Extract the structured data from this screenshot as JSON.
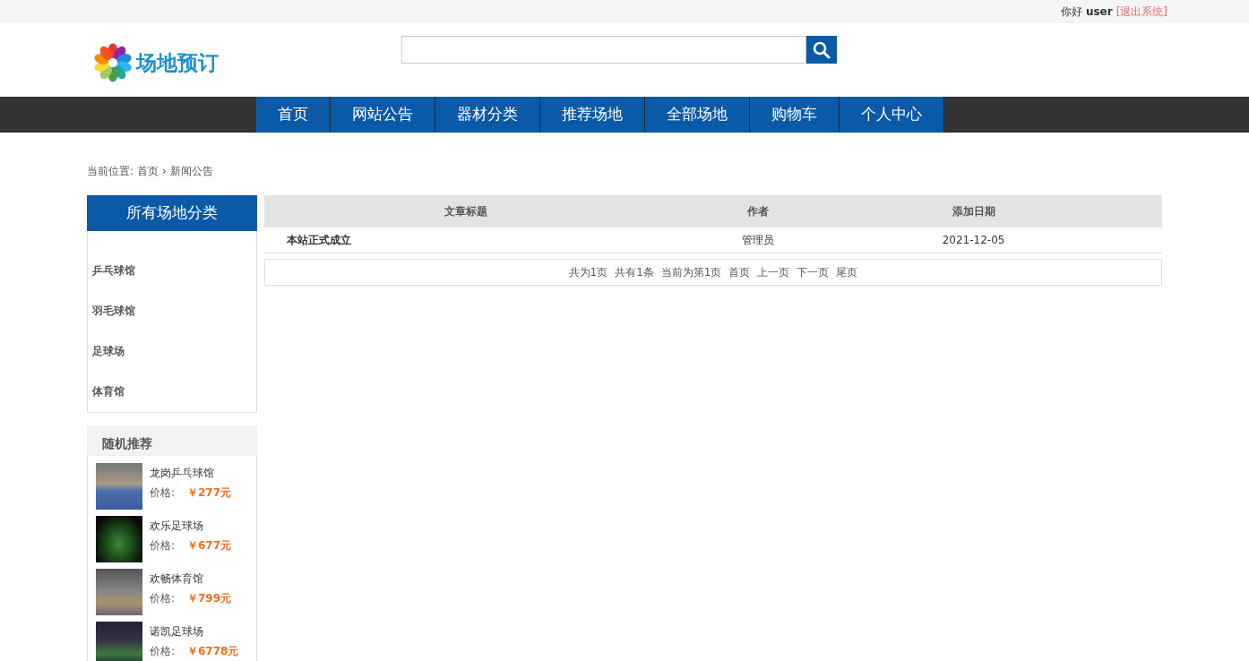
{
  "topbar": {
    "greeting": "你好",
    "username": "user",
    "logout": "[退出系统]"
  },
  "logo": {
    "text": "场地预订"
  },
  "nav": [
    {
      "label": "首页"
    },
    {
      "label": "网站公告"
    },
    {
      "label": "器材分类"
    },
    {
      "label": "推荐场地"
    },
    {
      "label": "全部场地"
    },
    {
      "label": "购物车"
    },
    {
      "label": "个人中心"
    }
  ],
  "breadcrumb": {
    "prefix": "当前位置:",
    "items": [
      "首页",
      "新闻公告"
    ],
    "separator": "›"
  },
  "sidebar": {
    "title": "所有场地分类",
    "items": [
      "乒乓球馆",
      "羽毛球馆",
      "足球场",
      "体育馆"
    ]
  },
  "recommend": {
    "title": "随机推荐",
    "items": [
      {
        "name": "龙岗乒乓球馆",
        "price_label": "价格:",
        "price": "￥277元"
      },
      {
        "name": "欢乐足球场",
        "price_label": "价格:",
        "price": "￥677元"
      },
      {
        "name": "欢畅体育馆",
        "price_label": "价格:",
        "price": "￥799元"
      },
      {
        "name": "诺凯足球场",
        "price_label": "价格:",
        "price": "￥6778元"
      }
    ]
  },
  "table": {
    "columns": [
      "文章标题",
      "作者",
      "添加日期"
    ],
    "rows": [
      {
        "title": "本站正式成立",
        "author": "管理员",
        "date": "2021-12-05"
      }
    ]
  },
  "pagination": {
    "info": [
      "共为1页",
      "共有1条",
      "当前为第1页"
    ],
    "links": [
      "首页",
      "上一页",
      "下一页",
      "尾页"
    ]
  }
}
